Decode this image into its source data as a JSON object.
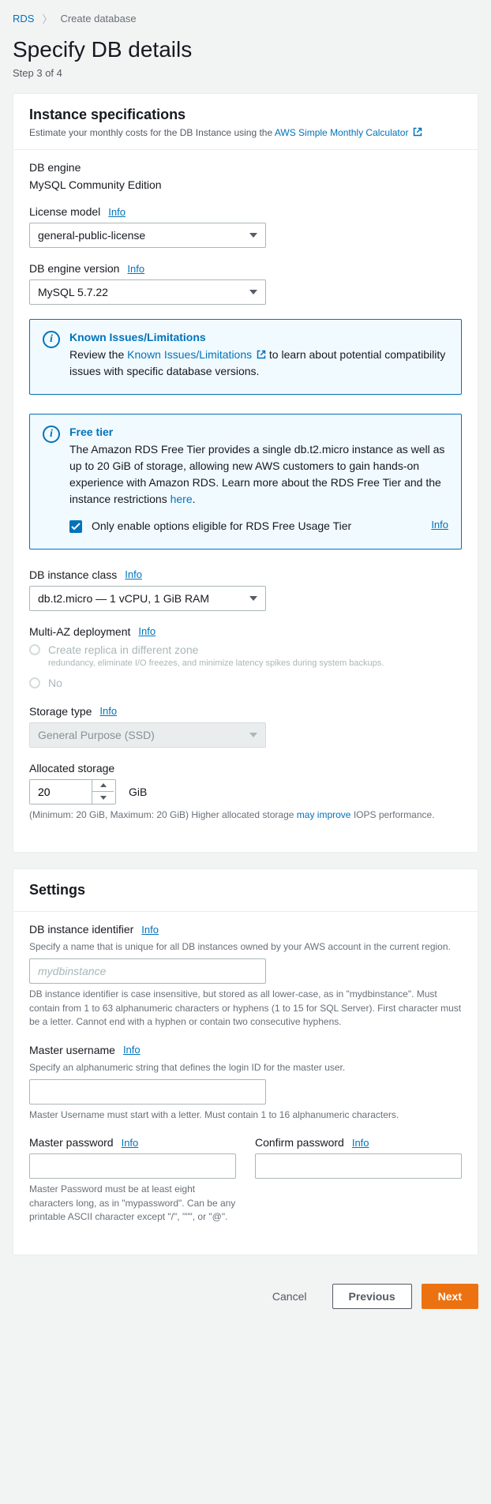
{
  "breadcrumb": {
    "root": "RDS",
    "current": "Create database"
  },
  "page": {
    "title": "Specify DB details",
    "step": "Step 3 of 4"
  },
  "instance": {
    "heading": "Instance specifications",
    "desc_pre": "Estimate your monthly costs for the DB Instance using the ",
    "calc_link": "AWS Simple Monthly Calculator",
    "db_engine_label": "DB engine",
    "db_engine_value": "MySQL Community Edition",
    "license_label": "License model",
    "license_value": "general-public-license",
    "version_label": "DB engine version",
    "version_value": "MySQL 5.7.22",
    "info": "Info",
    "known_issues": {
      "title": "Known Issues/Limitations",
      "pre": "Review the ",
      "link": "Known Issues/Limitations",
      "post": " to learn about potential compatibility issues with specific database versions."
    },
    "free_tier": {
      "title": "Free tier",
      "body_pre": "The Amazon RDS Free Tier provides a single db.t2.micro instance as well as up to 20 GiB of storage, allowing new AWS customers to gain hands-on experience with Amazon RDS. Learn more about the RDS Free Tier and the instance restrictions ",
      "here": "here",
      "body_post": ".",
      "checkbox_label": "Only enable options eligible for RDS Free Usage Tier"
    },
    "class_label": "DB instance class",
    "class_value": "db.t2.micro — 1 vCPU, 1 GiB RAM",
    "multiaz_label": "Multi-AZ deployment",
    "multiaz_opt1": "Create replica in different zone",
    "multiaz_opt1_sub": "redundancy, eliminate I/O freezes, and minimize latency spikes during system backups.",
    "multiaz_opt2": "No",
    "storage_type_label": "Storage type",
    "storage_type_value": "General Purpose (SSD)",
    "allocated_label": "Allocated storage",
    "allocated_value": "20",
    "allocated_unit": "GiB",
    "allocated_help_pre": "(Minimum: 20 GiB, Maximum: 20 GiB) Higher allocated storage ",
    "allocated_help_link": "may improve",
    "allocated_help_post": " IOPS performance."
  },
  "settings": {
    "heading": "Settings",
    "identifier_label": "DB instance identifier",
    "identifier_desc": "Specify a name that is unique for all DB instances owned by your AWS account in the current region.",
    "identifier_placeholder": "mydbinstance",
    "identifier_help": "DB instance identifier is case insensitive, but stored as all lower-case, as in \"mydbinstance\". Must contain from 1 to 63 alphanumeric characters or hyphens (1 to 15 for SQL Server). First character must be a letter. Cannot end with a hyphen or contain two consecutive hyphens.",
    "username_label": "Master username",
    "username_desc": "Specify an alphanumeric string that defines the login ID for the master user.",
    "username_help": "Master Username must start with a letter. Must contain 1 to 16 alphanumeric characters.",
    "password_label": "Master password",
    "confirm_label": "Confirm password",
    "password_help": "Master Password must be at least eight characters long, as in \"mypassword\". Can be any printable ASCII character except \"/\", \"\"\", or \"@\"."
  },
  "footer": {
    "cancel": "Cancel",
    "previous": "Previous",
    "next": "Next"
  }
}
